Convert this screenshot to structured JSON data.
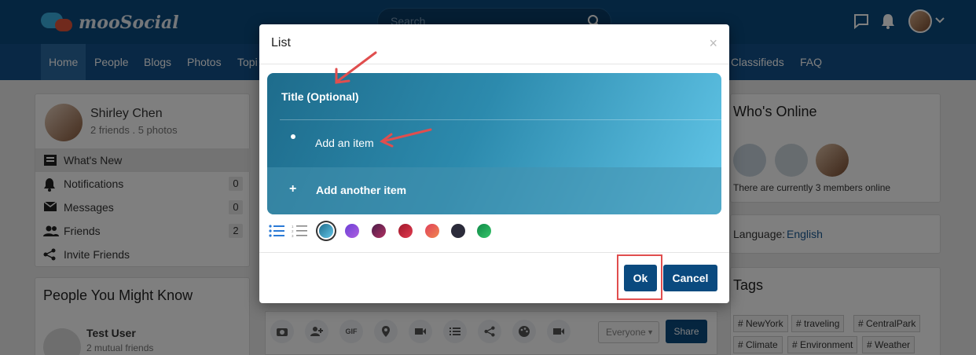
{
  "header": {
    "logo_text": "mooSocial",
    "search_placeholder": "Search"
  },
  "nav": {
    "items": [
      "Home",
      "People",
      "Blogs",
      "Photos",
      "Topi",
      "Classifieds",
      "FAQ"
    ]
  },
  "profile": {
    "name": "Shirley Chen",
    "stats": "2 friends . 5 photos",
    "menu": [
      {
        "label": "What's New",
        "count": null
      },
      {
        "label": "Notifications",
        "count": "0"
      },
      {
        "label": "Messages",
        "count": "0"
      },
      {
        "label": "Friends",
        "count": "2"
      },
      {
        "label": "Invite Friends",
        "count": null
      }
    ]
  },
  "people_you_might_know": {
    "title": "People You Might Know",
    "user_name": "Test User",
    "user_sub": "2 mutual friends"
  },
  "composer": {
    "privacy": "Everyone",
    "share": "Share"
  },
  "whos_online": {
    "title": "Who's Online",
    "text": "There are currently 3 members online"
  },
  "language": {
    "label": "Language:",
    "value": "English"
  },
  "tags": {
    "title": "Tags",
    "items": [
      "# NewYork",
      "# traveling",
      "# CentralPark",
      "# Climate",
      "# Environment",
      "# Weather"
    ]
  },
  "modal": {
    "title": "List",
    "close": "×",
    "list_title": "Title (Optional)",
    "item": "Add an item",
    "add_another": "Add another item",
    "plus": "+",
    "ok": "Ok",
    "cancel": "Cancel"
  },
  "colors": {
    "brand": "#0a4a7f",
    "swatches": [
      "#2a86a9",
      "#8a4fd6",
      "#7a2a5a",
      "#c6283c",
      "#e85a52",
      "#2b2b3a",
      "#1aa858"
    ],
    "highlight": "#e04e4e"
  }
}
